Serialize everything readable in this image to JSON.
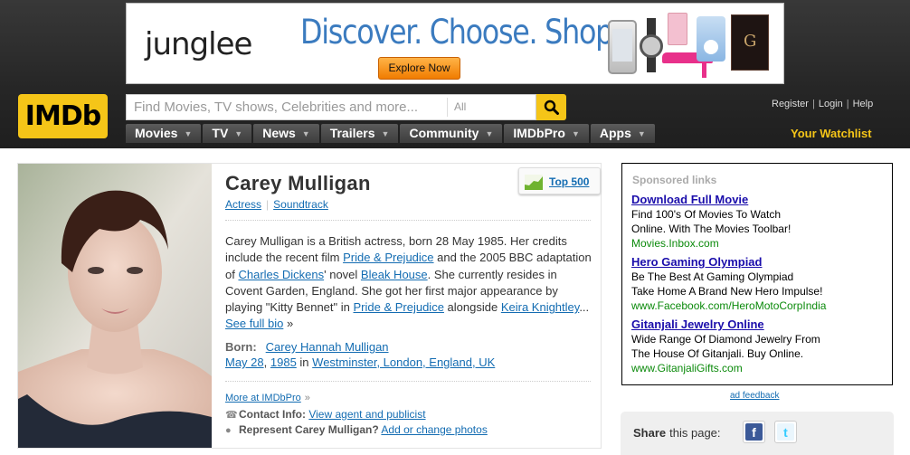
{
  "ad": {
    "brand": "junglee",
    "tagline": "Discover. Choose. Shop.",
    "cta": "Explore Now"
  },
  "header": {
    "logo": "IMDb",
    "search_placeholder": "Find Movies, TV shows, Celebrities and more...",
    "search_category": "All",
    "nav": [
      {
        "label": "Movies"
      },
      {
        "label": "TV"
      },
      {
        "label": "News"
      },
      {
        "label": "Trailers"
      },
      {
        "label": "Community"
      },
      {
        "label": "IMDbPro"
      },
      {
        "label": "Apps"
      }
    ],
    "user_links": [
      "Register",
      "Login",
      "Help"
    ],
    "watchlist": "Your Watchlist"
  },
  "person": {
    "name": "Carey Mulligan",
    "professions": [
      "Actress",
      "Soundtrack"
    ],
    "top500": "Top 500",
    "bio": {
      "p1": "Carey Mulligan is a British actress, born 28 May 1985. Her credits include the recent film ",
      "l1": "Pride & Prejudice",
      "p2": " and the 2005 BBC adaptation of ",
      "l2": "Charles Dickens",
      "p3": "' novel ",
      "l3": "Bleak House",
      "p4": ". She currently resides in Covent Garden, England. She got her first major appearance by playing \"Kitty Bennet\" in ",
      "l4": "Pride & Prejudice",
      "p5": " alongside ",
      "l5": "Keira Knightley",
      "p6": "... ",
      "l6": "See full bio",
      "p7": " »"
    },
    "born_label": "Born:",
    "born_name": "Carey Hannah Mulligan",
    "born_date": "May 28",
    "born_year": "1985",
    "born_in": "in",
    "born_place": "Westminster, London, England, UK",
    "more_at": "More at IMDbPro",
    "more_at_arrow": "»",
    "contact_label": "Contact Info:",
    "contact_link": "View agent and publicist",
    "represent_label": "Represent Carey Mulligan?",
    "represent_link": "Add or change photos"
  },
  "sponsored": {
    "title": "Sponsored links",
    "ads": [
      {
        "headline": "Download Full Movie",
        "line1": "Find 100's Of Movies To Watch",
        "line2": "Online. With The Movies Toolbar!",
        "url": "Movies.Inbox.com"
      },
      {
        "headline": "Hero Gaming Olympiad",
        "line1": "Be The Best At Gaming Olympiad",
        "line2": "Take Home A Brand New Hero Impulse!",
        "url": "www.Facebook.com/HeroMotoCorpIndia"
      },
      {
        "headline": "Gitanjali Jewelry Online",
        "line1": "Wide Range Of Diamond Jewelry From",
        "line2": "The House Of Gitanjali. Buy Online.",
        "url": "www.GitanjaliGifts.com"
      }
    ],
    "feedback": "ad feedback"
  },
  "share": {
    "label": "Share",
    "suffix": "this page:",
    "icons": [
      "facebook-icon",
      "twitter-icon"
    ]
  },
  "colors": {
    "imdb_yellow": "#f5c518",
    "link_blue": "#136cb2",
    "ad_url_green": "#0b8a0b",
    "header_dark": "#262626"
  }
}
